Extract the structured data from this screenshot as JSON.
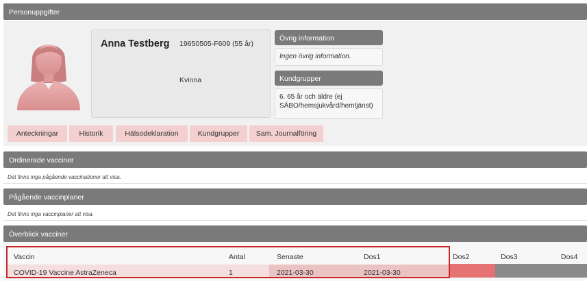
{
  "sections": {
    "personal": "Personuppgifter",
    "ordered": "Ordinerade vacciner",
    "ordered_empty": "Det finns inga pågående vaccinationer att visa.",
    "ongoing": "Pågående vaccinplaner",
    "ongoing_empty": "Det finns inga vaccinplaner att visa.",
    "overview": "Överblick vacciner"
  },
  "patient": {
    "name": "Anna Testberg",
    "id": "19650505-F609 (55 år)",
    "gender": "Kvinna"
  },
  "info": {
    "other_header": "Övrig information",
    "other_body": "Ingen övrig information.",
    "groups_header": "Kundgrupper",
    "groups_body": "6. 65 år och äldre (ej SÄBO/hemsjukvård/hemtjänst)"
  },
  "tabs": [
    "Anteckningar",
    "Historik",
    "Hälsodeklaration",
    "Kundgrupper",
    "Sam. Journalföring"
  ],
  "table": {
    "headers": [
      "Vaccin",
      "Antal",
      "Senaste",
      "Dos1",
      "Dos2",
      "Dos3",
      "Dos4"
    ],
    "rows": [
      [
        "COVID-19 Vaccine AstraZeneca",
        "1",
        "2021-03-30",
        "2021-03-30"
      ]
    ]
  },
  "colors": {
    "header_grey": "#7a7a7a",
    "tab_pink": "#f3cfcf",
    "highlight_red": "#c62828",
    "dose_red": "#e57373",
    "avatar_pink": "#e8a9a9"
  }
}
